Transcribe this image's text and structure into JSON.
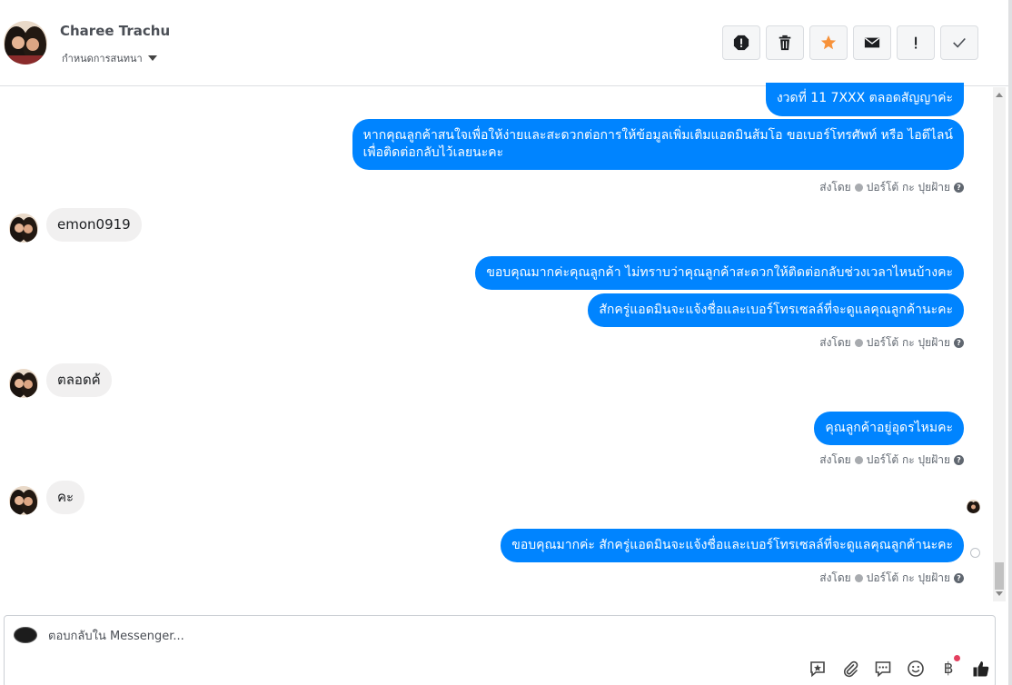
{
  "header": {
    "contact_name": "Charee Trachu",
    "assign_label": "กำหนดการสนทนา"
  },
  "messages": {
    "m1": "งวดที่ 11 7XXX  ตลอดสัญญาค่ะ",
    "m2_line1": "หากคุณลูกค้าสนใจเพื่อให้ง่ายและสะดวกต่อการให้ข้อมูลเพิ่มเติมแอดมินส้มโอ ขอเบอร์โทรศัพท์ หรือ ไอดีไลน์",
    "m2_line2": "เพื่อติดต่อกลับไว้เลยนะคะ",
    "in1": "emon0919",
    "m3": "ขอบคุณมากค่ะคุณลูกค้า ไม่ทราบว่าคุณลูกค้าสะดวกให้ติดต่อกลับช่วงเวลาไหนบ้างคะ",
    "m4": "สักครู่แอดมินจะแจ้งชื่อและเบอร์โทรเซลล์ที่จะดูแลคุณลูกค้านะคะ",
    "in2": "ตลอดค้",
    "m5": "คุณลูกค้าอยู่อุดรไหมคะ",
    "in3": "คะ",
    "m6": "ขอบคุณมากค่ะ  สักครู่แอดมินจะแจ้งชื่อและเบอร์โทรเซลล์ที่จะดูแลคุณลูกค้านะคะ"
  },
  "sent_by": {
    "prefix": "ส่งโดย",
    "name": "ปอร์โต้ กะ ปุยฝ้าย"
  },
  "composer": {
    "placeholder": "ตอบกลับใน Messenger..."
  },
  "icons": {
    "header_actions": [
      "alert-icon",
      "trash-icon",
      "star-icon",
      "envelope-icon",
      "exclamation-icon",
      "check-icon"
    ],
    "composer_tools": [
      "saved-reply-icon",
      "attachment-icon",
      "chat-icon",
      "emoji-icon",
      "baht-icon",
      "thumbs-up-icon"
    ]
  },
  "colors": {
    "outgoing_bubble": "#0084ff",
    "incoming_bubble": "#f1f0f0",
    "star": "#f7923a",
    "notification_dot": "#e4405f"
  }
}
